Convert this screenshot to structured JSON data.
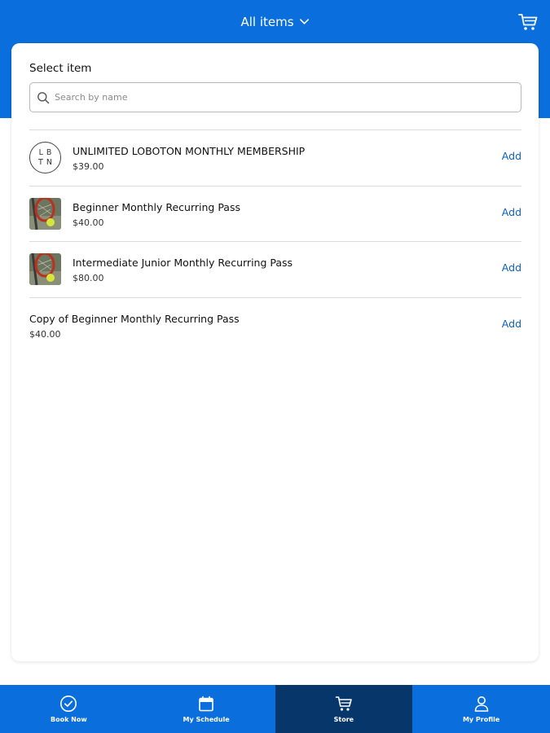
{
  "header": {
    "title": "All items",
    "chevron_icon": "chevron-down-icon",
    "cart_icon": "cart-icon",
    "color": "#0a6fdc"
  },
  "picker": {
    "label": "Select item",
    "search_placeholder": "Search by name",
    "search_value": ""
  },
  "items": [
    {
      "name": "UNLIMITED LOBOTON MONTHLY MEMBERSHIP",
      "price": "$39.00",
      "action": "Add",
      "thumb": "logo",
      "logo_line1": "LB",
      "logo_line2": "TN"
    },
    {
      "name": "Beginner Monthly Recurring Pass",
      "price": "$40.00",
      "action": "Add",
      "thumb": "tennis-photo"
    },
    {
      "name": "Intermediate Junior Monthly Recurring Pass",
      "price": "$80.00",
      "action": "Add",
      "thumb": "tennis-photo"
    },
    {
      "name": "Copy of Beginner Monthly Recurring Pass",
      "price": "$40.00",
      "action": "Add",
      "thumb": "none"
    }
  ],
  "tabs": [
    {
      "label": "Book Now",
      "icon": "check-circle-icon",
      "active": false
    },
    {
      "label": "My Schedule",
      "icon": "calendar-icon",
      "active": false
    },
    {
      "label": "Store",
      "icon": "cart-icon",
      "active": true
    },
    {
      "label": "My Profile",
      "icon": "person-icon",
      "active": false
    }
  ],
  "colors": {
    "primary": "#0a6fdc",
    "active_tab": "#07366b",
    "link": "#0a5fc8"
  }
}
